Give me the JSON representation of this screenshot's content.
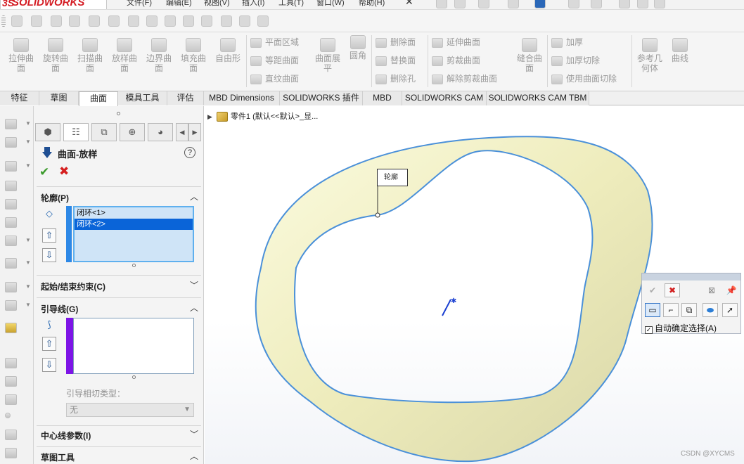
{
  "app": {
    "logo": "SOLIDWORKS",
    "menus": [
      "文件(F)",
      "编辑(E)",
      "视图(V)",
      "插入(I)",
      "工具(T)",
      "窗口(W)",
      "帮助(H)"
    ]
  },
  "ribbon": {
    "big_buttons": [
      {
        "label": "拉伸曲面",
        "icon": "extrude-surface-icon"
      },
      {
        "label": "旋转曲面",
        "icon": "revolve-surface-icon"
      },
      {
        "label": "扫描曲面",
        "icon": "sweep-surface-icon"
      },
      {
        "label": "放样曲面",
        "icon": "loft-surface-icon"
      },
      {
        "label": "边界曲面",
        "icon": "boundary-surface-icon"
      },
      {
        "label": "填充曲面",
        "icon": "fill-surface-icon"
      },
      {
        "label": "自由形",
        "icon": "freeform-icon"
      }
    ],
    "col2": [
      "平面区域",
      "等距曲面",
      "直纹曲面"
    ],
    "flatten": "曲面展平",
    "fillet": "圆角",
    "col3": [
      "删除面",
      "替换面",
      "删除孔"
    ],
    "col4": [
      "延伸曲面",
      "剪裁曲面",
      "解除剪裁曲面"
    ],
    "knit": "缝合曲面",
    "col5": [
      "加厚",
      "加厚切除",
      "使用曲面切除"
    ],
    "ref_geom": "参考几何体",
    "curves": "曲线"
  },
  "tabs": [
    "特征",
    "草图",
    "曲面",
    "模具工具",
    "评估",
    "MBD Dimensions",
    "SOLIDWORKS 插件",
    "MBD",
    "SOLIDWORKS CAM",
    "SOLIDWORKS CAM TBM"
  ],
  "active_tab": "曲面",
  "property_manager": {
    "title": "曲面-放样",
    "help": "?",
    "profile": {
      "heading": "轮廓(P)",
      "items": [
        "闭环<1>",
        "闭环<2>"
      ],
      "selected_index": 1
    },
    "constraints_heading": "起始/结束约束(C)",
    "guide": {
      "heading": "引导线(G)",
      "tangent_label": "引导相切类型：",
      "tangent_value": "无"
    },
    "centerline_heading": "中心线参数(I)",
    "sketch_tools_heading": "草图工具"
  },
  "graphics": {
    "tree_text": "零件1  (默认<<默认>_显...",
    "callout": "轮廓",
    "surface_color": "#f4f3c8",
    "edge_color": "#4a90d9"
  },
  "selection_toolbar": {
    "auto_select_label": "自动确定选择(A)",
    "auto_select_checked": true
  },
  "watermark": "CSDN @XYCMS"
}
